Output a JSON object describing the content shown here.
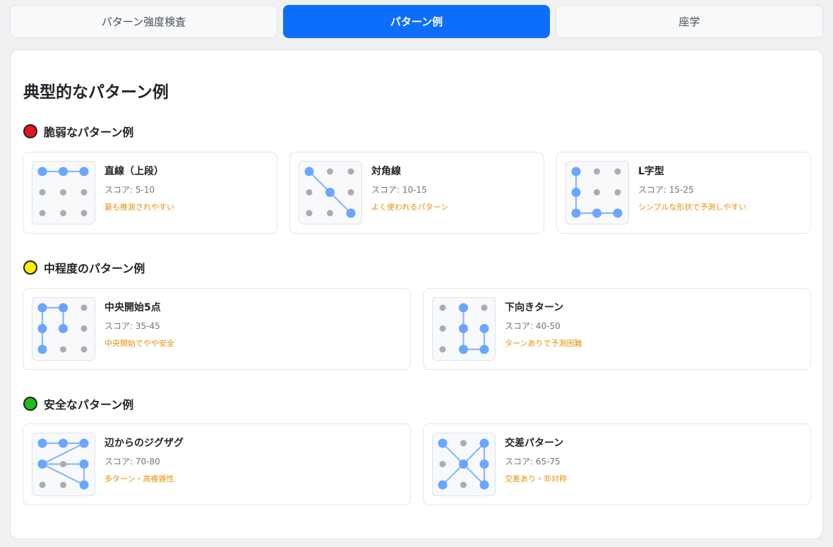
{
  "tabs": [
    {
      "label": "パターン強度検査",
      "active": false
    },
    {
      "label": "パターン例",
      "active": true
    },
    {
      "label": "座学",
      "active": false
    }
  ],
  "panel_title": "典型的なパターン例",
  "colors": {
    "accent": "#0d6efd",
    "weak": "#e8121f",
    "medium": "#ffee00",
    "safe": "#1bbd1b",
    "description": "#e8900c",
    "node_active": "#6aa6ff",
    "node_idle": "#a9adb2",
    "line": "#8ab8ff"
  },
  "sections": [
    {
      "label": "脆弱なパターン例",
      "level": "weak",
      "cards": [
        {
          "name": "直線（上段）",
          "score": "スコア: 5-10",
          "desc": "最も推測されやすい",
          "path": [
            0,
            1,
            2
          ]
        },
        {
          "name": "対角線",
          "score": "スコア: 10-15",
          "desc": "よく使われるパターン",
          "path": [
            0,
            4,
            8
          ]
        },
        {
          "name": "L字型",
          "score": "スコア: 15-25",
          "desc": "シンプルな形状で予測しやすい",
          "path": [
            0,
            3,
            6,
            7,
            8
          ]
        }
      ]
    },
    {
      "label": "中程度のパターン例",
      "level": "medium",
      "cards": [
        {
          "name": "中央開始5点",
          "score": "スコア: 35-45",
          "desc": "中央開始でやや安全",
          "path": [
            4,
            1,
            0,
            3,
            6
          ]
        },
        {
          "name": "下向きターン",
          "score": "スコア: 40-50",
          "desc": "ターンありで予測困難",
          "path": [
            1,
            4,
            7,
            8,
            5
          ]
        }
      ]
    },
    {
      "label": "安全なパターン例",
      "level": "safe",
      "cards": [
        {
          "name": "辺からのジグザグ",
          "score": "スコア: 70-80",
          "desc": "多ターン・高複雑性",
          "path": [
            0,
            1,
            2,
            3,
            5,
            8,
            3
          ]
        },
        {
          "name": "交差パターン",
          "score": "スコア: 65-75",
          "desc": "交差あり・非対称",
          "path": [
            0,
            4,
            8,
            5,
            2,
            4,
            6
          ]
        }
      ]
    }
  ]
}
